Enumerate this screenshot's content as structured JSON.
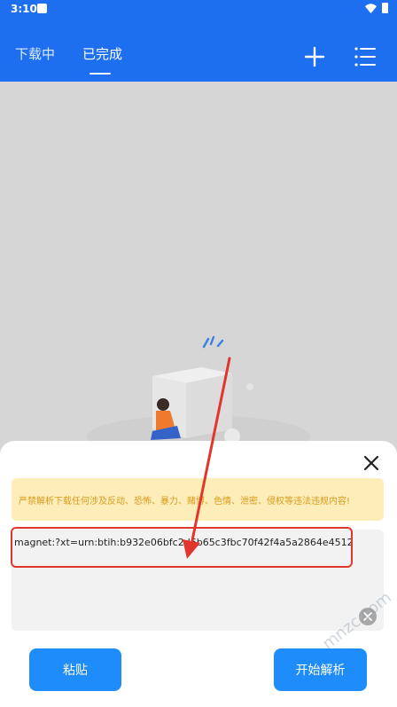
{
  "status_bar": {
    "time": "3:10"
  },
  "tabs": [
    {
      "label": "下载中",
      "active": false
    },
    {
      "label": "已完成",
      "active": true
    }
  ],
  "header": {
    "add_icon": "plus-icon",
    "menu_icon": "list-icon"
  },
  "sheet": {
    "warning": "严禁解析下载任何涉及反动、恐怖、暴力、赌博、色情、泄密、侵权等违法违规内容!",
    "magnet_link": "magnet:?xt=urn:btih:b932e06bfc2d6b65c3fbc70f42f4a5a2864e4512",
    "paste_label": "粘贴",
    "parse_label": "开始解析"
  },
  "colors": {
    "header_bg": "#1e6ff0",
    "button_bg": "#1e8cfa",
    "warning_bg": "#fdeeb9",
    "warning_text": "#d99a1c",
    "annotation_red": "#e0362c"
  },
  "watermark": "mnzc.com"
}
